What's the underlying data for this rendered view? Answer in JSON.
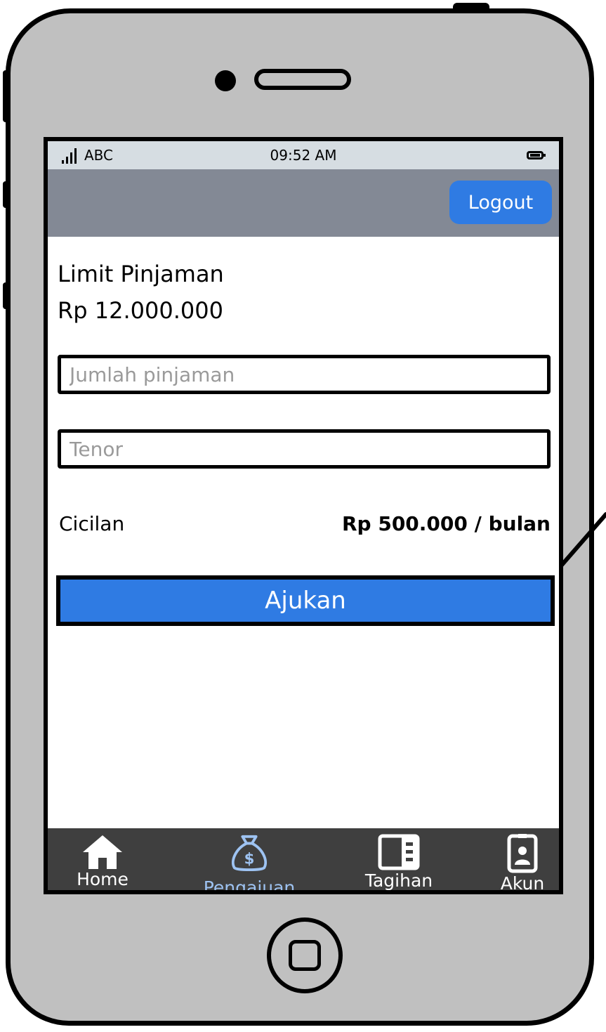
{
  "status_bar": {
    "carrier": "ABC",
    "time": "09:52 AM"
  },
  "header": {
    "logout_label": "Logout"
  },
  "loan": {
    "limit_label": "Limit Pinjaman",
    "limit_value": "Rp 12.000.000",
    "amount_placeholder": "Jumlah pinjaman",
    "tenor_placeholder": "Tenor",
    "installment_label": "Cicilan",
    "installment_value": "Rp 500.000 / bulan",
    "submit_label": "Ajukan"
  },
  "bottom_nav": {
    "items": [
      {
        "label": "Home",
        "icon": "home-icon"
      },
      {
        "label": "Pengajuan",
        "icon": "money-bag-icon",
        "active": true
      },
      {
        "label": "Tagihan",
        "icon": "bill-icon"
      },
      {
        "label": "Akun",
        "icon": "account-icon"
      }
    ]
  },
  "colors": {
    "accent": "#2f7be3",
    "header_bg": "#838995",
    "status_bg": "#d6dde2",
    "nav_bg": "#3f3f3f",
    "nav_active": "#9ec3f2",
    "device": "#c0c0c0"
  }
}
